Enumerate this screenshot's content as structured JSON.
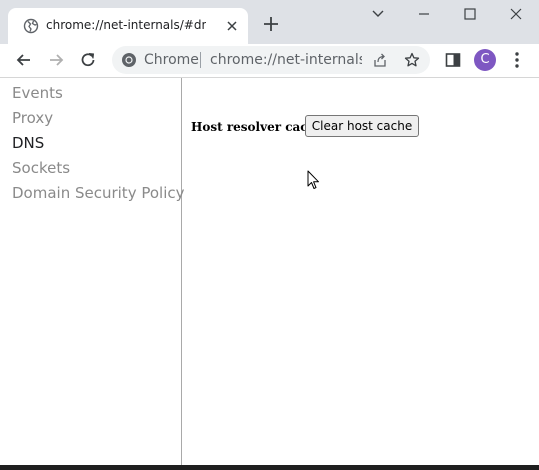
{
  "tab": {
    "title": "chrome://net-internals/#dns",
    "favicon": "globe-icon",
    "close": "close-icon"
  },
  "new_tab": "plus-icon",
  "window_controls": [
    "chevron-down-icon",
    "minimize-icon",
    "maximize-icon",
    "close-icon"
  ],
  "toolbar": {
    "back": "arrow-left-icon",
    "forward": "arrow-right-icon",
    "reload": "reload-icon",
    "omnibox": {
      "origin_label": "Chrome",
      "url": "chrome://net-internals/..."
    },
    "share": "share-icon",
    "bookmark": "star-icon",
    "side_panel": "side-panel-icon",
    "profile_initial": "C",
    "menu": "kebab-menu-icon"
  },
  "sidebar": {
    "items": [
      {
        "label": "Events",
        "selected": false
      },
      {
        "label": "Proxy",
        "selected": false
      },
      {
        "label": "DNS",
        "selected": true
      },
      {
        "label": "Sockets",
        "selected": false
      },
      {
        "label": "Domain Security Policy",
        "selected": false
      }
    ]
  },
  "main": {
    "resolver_label": "Host resolver cache",
    "clear_button": "Clear host cache"
  },
  "colors": {
    "tabstrip": "#dee1e6",
    "omnibox": "#f1f3f4",
    "avatar": "#7e57c2",
    "nav_inactive": "#8a8a8a",
    "nav_selected": "#202124"
  }
}
